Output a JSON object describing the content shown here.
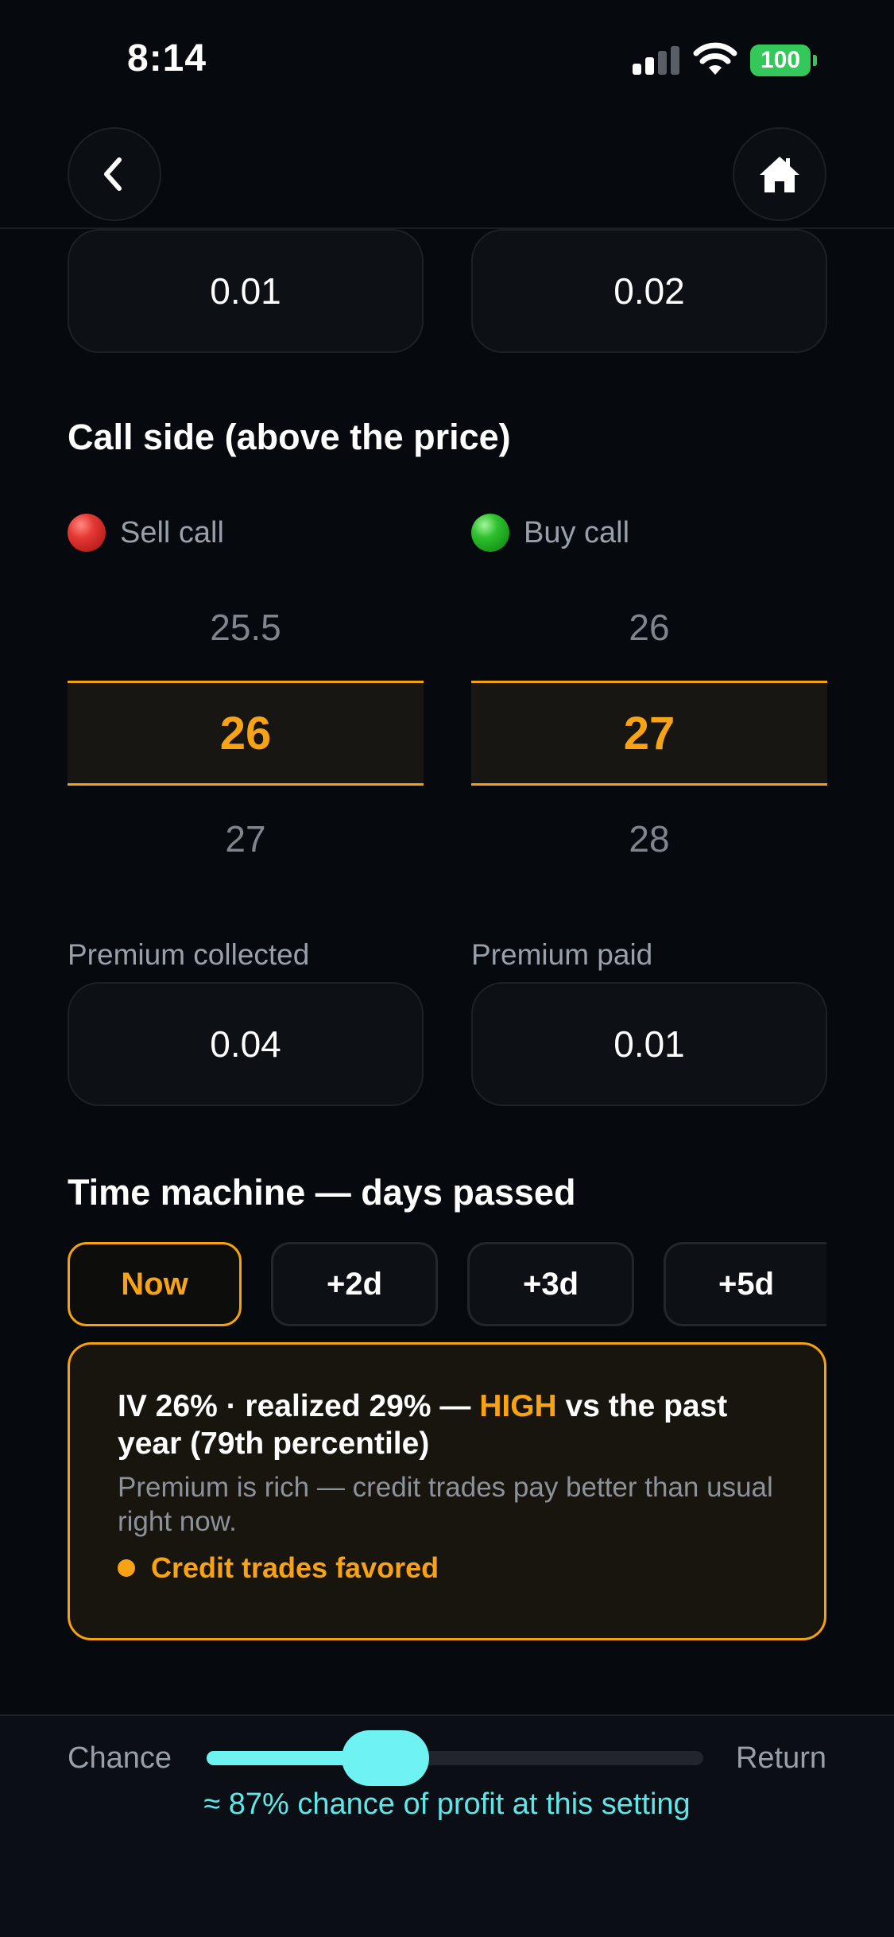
{
  "status_bar": {
    "time": "8:14",
    "battery": "100"
  },
  "top_values": {
    "left": "0.01",
    "right": "0.02"
  },
  "call_side": {
    "title": "Call side (above the price)",
    "sell": {
      "label": "Sell call",
      "above": "25.5",
      "selected": "26",
      "below": "27"
    },
    "buy": {
      "label": "Buy call",
      "above": "26",
      "selected": "27",
      "below": "28"
    }
  },
  "premiums": {
    "collected_label": "Premium collected",
    "collected_value": "0.04",
    "paid_label": "Premium paid",
    "paid_value": "0.01"
  },
  "time_machine": {
    "title": "Time machine — days passed",
    "chips": [
      "Now",
      "+2d",
      "+3d",
      "+5d"
    ],
    "active": "Now"
  },
  "iv_card": {
    "headline_pre": "IV 26% · realized 29% — ",
    "headline_high": "HIGH",
    "headline_post": " vs the past year (79th percentile)",
    "sub": "Premium is rich — credit trades pay better than usual right now.",
    "badge": "Credit trades favored"
  },
  "slider": {
    "left_label": "Chance",
    "right_label": "Return",
    "value_fraction": 0.36,
    "caption": "≈ 87% chance of profit at this setting"
  },
  "colors": {
    "accent": "#f8a316",
    "cyan": "#6ff2f2",
    "background": "#060a0f"
  }
}
